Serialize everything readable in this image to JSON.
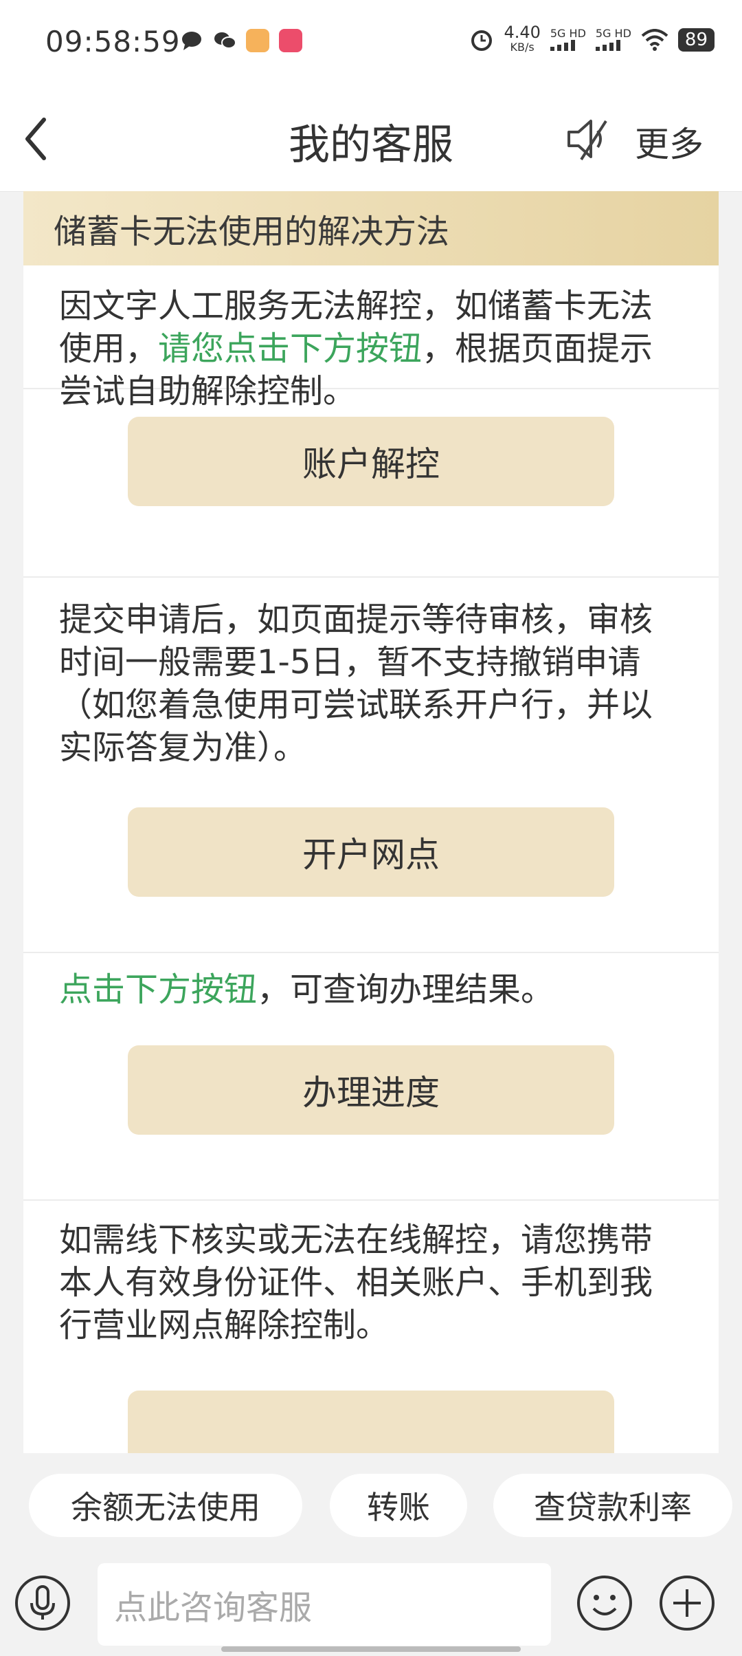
{
  "status_bar": {
    "time": "09:58:59",
    "speed_value": "4.40",
    "speed_unit": "KB/s",
    "network_1": "5G HD",
    "network_2": "5G HD",
    "battery": "89"
  },
  "header": {
    "title": "我的客服",
    "more_label": "更多"
  },
  "card": {
    "heading": "储蓄卡无法使用的解决方法",
    "section1": {
      "text_a": "因文字人工服务无法解控，如储蓄卡无法使用，",
      "text_green": "请您点击下方按钮",
      "text_b": "，根据页面提示尝试自助解除控制。"
    },
    "button1": "账户解控",
    "section2": {
      "text": "提交申请后，如页面提示等待审核，审核时间一般需要1-5日，暂不支持撤销申请（如您着急使用可尝试联系开户行，并以实际答复为准）。"
    },
    "button2": "开户网点",
    "section3": {
      "text_green": "点击下方按钮",
      "text_b": "，可查询办理结果。"
    },
    "button3": "办理进度",
    "section4": {
      "text": "如需线下核实或无法在线解控，请您携带本人有效身份证件、相关账户、手机到我行营业网点解除控制。"
    }
  },
  "quick_replies": [
    "余额无法使用",
    "转账",
    "查贷款利率"
  ],
  "input": {
    "placeholder": "点此咨询客服"
  },
  "colors": {
    "accent_green": "#3ca55c",
    "button_bg": "#f0e3c6",
    "heading_bg": "#e6d3a2"
  }
}
